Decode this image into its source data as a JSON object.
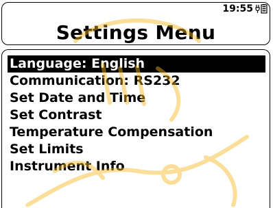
{
  "status": {
    "time": "19:55",
    "icon": "battery-charging-icon"
  },
  "header": {
    "title": "Settings Menu"
  },
  "menu": {
    "items": [
      {
        "label": "Language: English",
        "selected": true
      },
      {
        "label": "Communication: RS232",
        "selected": false
      },
      {
        "label": "Set Date and Time",
        "selected": false
      },
      {
        "label": "Set Contrast",
        "selected": false
      },
      {
        "label": "Temperature Compensation",
        "selected": false
      },
      {
        "label": "Set Limits",
        "selected": false
      },
      {
        "label": "Instrument Info",
        "selected": false
      }
    ]
  },
  "watermark": {
    "color": "#f5b820"
  }
}
